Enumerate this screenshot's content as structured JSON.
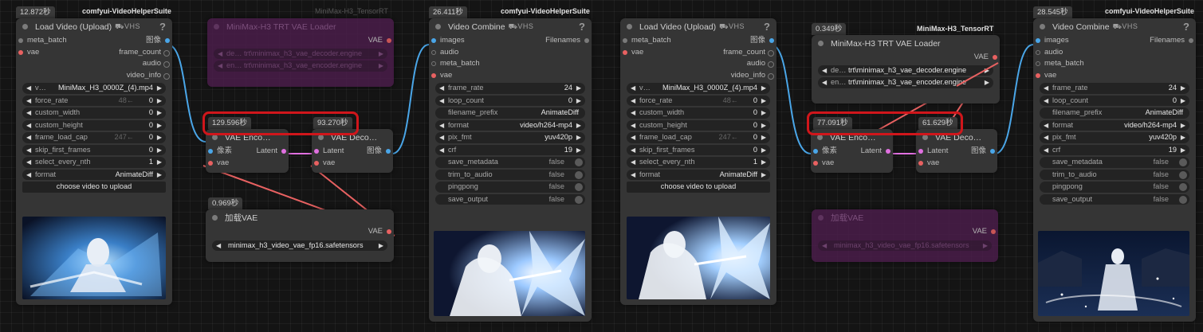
{
  "strings": {
    "suite": "comfyui-VideoHelperSuite",
    "tensorrt": "MiniMax-H3_TensorRT",
    "vhs_badge": "⛟VHS",
    "help": "?",
    "trt_loader_title": "MiniMax-H3 TRT VAE Loader",
    "decoder_name": "de…",
    "decoder_value": "trt\\minimax_h3_vae_decoder.engine",
    "encoder_name": "en…",
    "encoder_value": "trt\\minimax_h3_vae_encoder.engine",
    "vae": "VAE",
    "vae_lower": "vae",
    "load_video_title": "Load Video (Upload)",
    "meta_batch": "meta_batch",
    "frame_count": "frame_count",
    "audio": "audio",
    "video_info": "video_info",
    "image_cn": "图像",
    "pixel_cn": "像素",
    "latent": "Latent",
    "video_name": "v…",
    "video_file": "MiniMax_H3_0000Z_(4).mp4",
    "force_rate": "force_rate",
    "force_rate_hint": "48←",
    "zero": "0",
    "one": "1",
    "custom_width": "custom_width",
    "custom_height": "custom_height",
    "frame_load_cap": "frame_load_cap",
    "frame_load_cap_hint": "247←",
    "skip_first_frames": "skip_first_frames",
    "select_every_nth": "select_every_nth",
    "format": "format",
    "animatediff": "AnimateDiff",
    "choose_video": "choose video to upload",
    "vae_encode_title": "VAE Enco…",
    "vae_decode_title": "VAE Deco…",
    "load_vae_title": "加载VAE",
    "vae_file": "minimax_h3_video_vae_fp16.safetensors",
    "video_combine_title": "Video Combine",
    "images": "images",
    "filenames": "Filenames",
    "frame_rate": "frame_rate",
    "frame_rate_val": "24",
    "loop_count": "loop_count",
    "filename_prefix": "filename_prefix",
    "format_val": "video/h264-mp4",
    "pix_fmt": "pix_fmt",
    "pix_fmt_val": "yuv420p",
    "crf": "crf",
    "crf_val": "19",
    "save_metadata": "save_metadata",
    "trim_to_audio": "trim_to_audio",
    "pingpong": "pingpong",
    "save_output": "save_output",
    "false": "false"
  },
  "timers": {
    "load_video_1": "12.872秒",
    "combine_1": "26.411秒",
    "encode_1": "129.596秒",
    "decode_1": "93.270秒",
    "load_vae_1": "0.969秒",
    "trt_loader_2": "0.349秒",
    "encode_2": "77.091秒",
    "decode_2": "61.629秒",
    "combine_2": "28.545秒"
  },
  "colors": {
    "image_link": "#4aa6e8",
    "vae_link": "#e86161",
    "latent_link": "#e070e0",
    "highlight_box": "#d0161b",
    "bypassed_node": "#4a1d4a"
  }
}
